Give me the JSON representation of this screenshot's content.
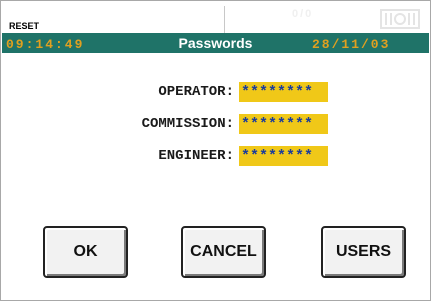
{
  "header": {
    "reset_label": "RESET",
    "counter": "0/0",
    "time": "09:14:49",
    "title": "Passwords",
    "date": "28/11/03"
  },
  "passwords": [
    {
      "label": "OPERATOR:",
      "value": "********"
    },
    {
      "label": "COMMISSION:",
      "value": "********"
    },
    {
      "label": "ENGINEER:",
      "value": "********"
    }
  ],
  "buttons": {
    "ok": "OK",
    "cancel": "CANCEL",
    "users": "USERS"
  },
  "colors": {
    "status_bar": "#1f7368",
    "clock_text": "#e0a020",
    "field_bg": "#f0c818",
    "field_text": "#1a3c9c"
  },
  "icons": {
    "status_indicator": "signal-indicator-icon"
  }
}
